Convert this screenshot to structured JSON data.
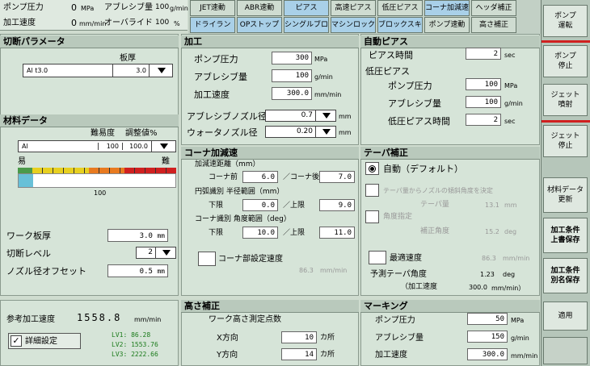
{
  "status": {
    "pump_label": "ポンプ圧力",
    "pump_value": "0",
    "pump_unit": "MPa",
    "abrasive_label": "アブレシブ量",
    "abrasive_value": "100",
    "abrasive_unit": "g/min",
    "speed_label": "加工速度",
    "speed_value": "0",
    "speed_unit": "mm/min",
    "override_label": "オーバライド",
    "override_value": "100",
    "override_unit": "%"
  },
  "toolbar": {
    "row1": [
      "JET速動",
      "ABR速動",
      "ピアス",
      "高速ピアス",
      "低圧ピアス",
      "コーナ加減速",
      "ヘッダ補正"
    ],
    "row2": [
      "ドライラン",
      "OPストップ",
      "シングルブロック",
      "マシンロック",
      "ブロックスキップ",
      "ポンプ速動",
      "高さ補正"
    ]
  },
  "cut_param": {
    "title": "切断パラメータ",
    "thickness_label": "板厚",
    "material": "Al t3.0",
    "thickness": "3.0"
  },
  "material_data": {
    "title": "材料データ",
    "difficulty_label": "難易度",
    "adjust_label": "調整値%",
    "material": "Al",
    "difficulty": "100",
    "adjust": "100.0",
    "easy": "易",
    "hard": "難",
    "scale_value": "100"
  },
  "work": {
    "thickness_label": "ワーク板厚",
    "thickness": "3.0",
    "thickness_unit": "mm",
    "level_label": "切断レベル",
    "level": "2",
    "nozzle_label": "ノズル径オフセット",
    "nozzle": "0.5",
    "nozzle_unit": "mm"
  },
  "bottom_left": {
    "ref_label": "参考加工速度",
    "ref_value": "1558.8",
    "ref_unit": "mm/min",
    "detail_label": "詳細設定",
    "lv1": "LV1: 86.28",
    "lv2": "LV2: 1553.76",
    "lv3": "LV3: 2222.66"
  },
  "process": {
    "title": "加工",
    "pump_label": "ポンプ圧力",
    "pump": "300",
    "pump_unit": "MPa",
    "abr_label": "アブレシブ量",
    "abr": "100",
    "abr_unit": "g/min",
    "speed_label": "加工速度",
    "speed": "300.0",
    "speed_unit": "mm/min",
    "nozzle_label": "アブレシブノズル径",
    "nozzle": "0.7",
    "nozzle_unit": "mm",
    "water_label": "ウォータノズル径",
    "water": "0.20",
    "water_unit": "mm"
  },
  "pierce": {
    "title": "自動ピアス",
    "time_label": "ピアス時間",
    "time": "2",
    "time_unit": "sec",
    "low_title": "低圧ピアス",
    "pump_label": "ポンプ圧力",
    "pump": "100",
    "pump_unit": "MPa",
    "abr_label": "アブレシブ量",
    "abr": "100",
    "abr_unit": "g/min",
    "lowtime_label": "低圧ピアス時間",
    "lowtime": "2",
    "lowtime_unit": "sec"
  },
  "corner": {
    "title": "コーナ加減速",
    "dist_label": "加減速距離（mm）",
    "before_label": "コーナ前",
    "before": "6.0",
    "after_label": "／コーナ後",
    "after": "7.0",
    "arc_label": "円弧識別 半径範囲（mm）",
    "lower_label": "下限",
    "lower": "0.0",
    "upper_label": "／上限",
    "upper": "9.0",
    "angle_label": "コーナ識別 角度範囲（deg）",
    "alower_label": "下限",
    "alower": "10.0",
    "aupper_label": "／上限",
    "aupper": "11.0",
    "speed_label": "コーナ部設定速度",
    "speed": "86.3",
    "speed_unit": "mm/min"
  },
  "taper": {
    "title": "テーパ補正",
    "auto_label": "自動（デフォルト）",
    "calc_label": "テーパ量からノズルの傾斜角度を決定",
    "taper_label": "テーパ量",
    "taper": "13.1",
    "taper_unit": "mm",
    "angle_label": "角度指定",
    "corr_label": "補正角度",
    "corr": "15.2",
    "corr_unit": "deg",
    "max_label": "最適速度",
    "max": "86.3",
    "max_unit": "mm/min",
    "pred_label": "予測テーパ角度",
    "pred": "1.23",
    "pred_unit": "deg",
    "spd_label": "（加工速度",
    "spd": "300.0",
    "spd_unit": "mm/min）"
  },
  "height": {
    "title": "高さ補正",
    "points_label": "ワーク高さ測定点数",
    "x_label": "X方向",
    "x": "10",
    "x_unit": "カ所",
    "y_label": "Y方向",
    "y": "14",
    "y_unit": "カ所"
  },
  "marking": {
    "title": "マーキング",
    "pump_label": "ポンプ圧力",
    "pump": "50",
    "pump_unit": "MPa",
    "abr_label": "アブレシブ量",
    "abr": "150",
    "abr_unit": "g/min",
    "speed_label": "加工速度",
    "speed": "300.0",
    "speed_unit": "mm/min"
  },
  "sidebar": {
    "pump_on": "ポンプ\n運転",
    "pump_off": "ポンプ\n停止",
    "jet_on": "ジェット\n噴射",
    "jet_off": "ジェット\n停止",
    "material_update": "材料データ\n更新",
    "save_overwrite": "加工条件\n上書保存",
    "save_as": "加工条件\n別名保存",
    "apply": "適用"
  },
  "colors": {
    "accent_red": "#d02020",
    "active_blue": "#a9d0e8",
    "panel": "#d6e4d8"
  }
}
